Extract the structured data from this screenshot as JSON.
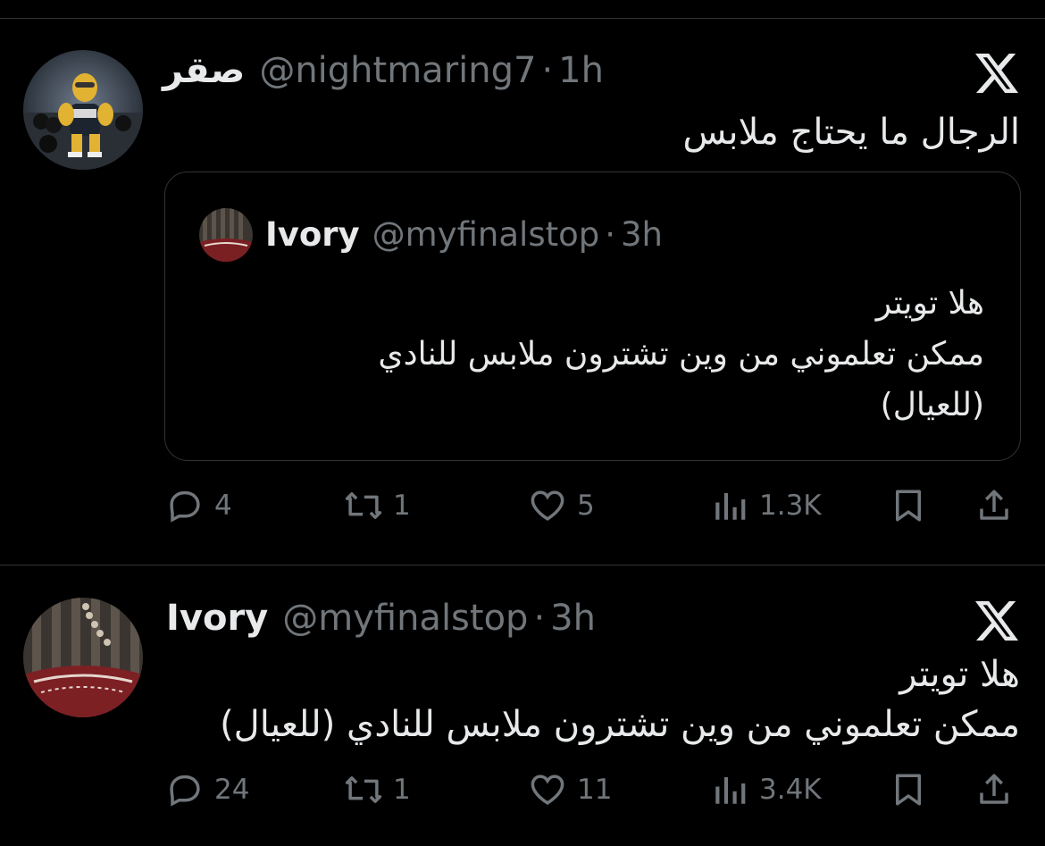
{
  "tweets": [
    {
      "author": {
        "name": "صقر",
        "handle": "@nightmaring7",
        "separator": "·",
        "time": "1h"
      },
      "avatar_icon": "avatar-bodybuilder-icon",
      "text_lines": [
        "الرجال ما يحتاج ملابس"
      ],
      "quote": {
        "author": {
          "name": "Ivory",
          "handle": "@myfinalstop",
          "separator": "·",
          "time": "3h"
        },
        "text_lines": [
          "هلا تويتر",
          "ممكن تعلموني من وين تشترون ملابس للنادي",
          "(للعيال)"
        ]
      },
      "stats": {
        "replies": "4",
        "retweets": "1",
        "likes": "5",
        "views": "1.3K"
      }
    },
    {
      "author": {
        "name": "Ivory",
        "handle": "@myfinalstop",
        "separator": "·",
        "time": "3h"
      },
      "avatar_icon": "avatar-ivory-icon",
      "text_lines": [
        "هلا تويتر",
        "ممكن تعلموني من وين تشترون ملابس للنادي (للعيال)"
      ],
      "stats": {
        "replies": "24",
        "retweets": "1",
        "likes": "11",
        "views": "3.4K"
      }
    }
  ],
  "icons": {
    "brand": "x-logo-icon",
    "reply": "reply-icon",
    "retweet": "retweet-icon",
    "like": "heart-icon",
    "views": "views-icon",
    "bookmark": "bookmark-icon",
    "share": "share-icon"
  },
  "colors": {
    "background": "#000000",
    "text": "#e7e9ea",
    "muted": "#71767b",
    "border": "#2f3336"
  }
}
